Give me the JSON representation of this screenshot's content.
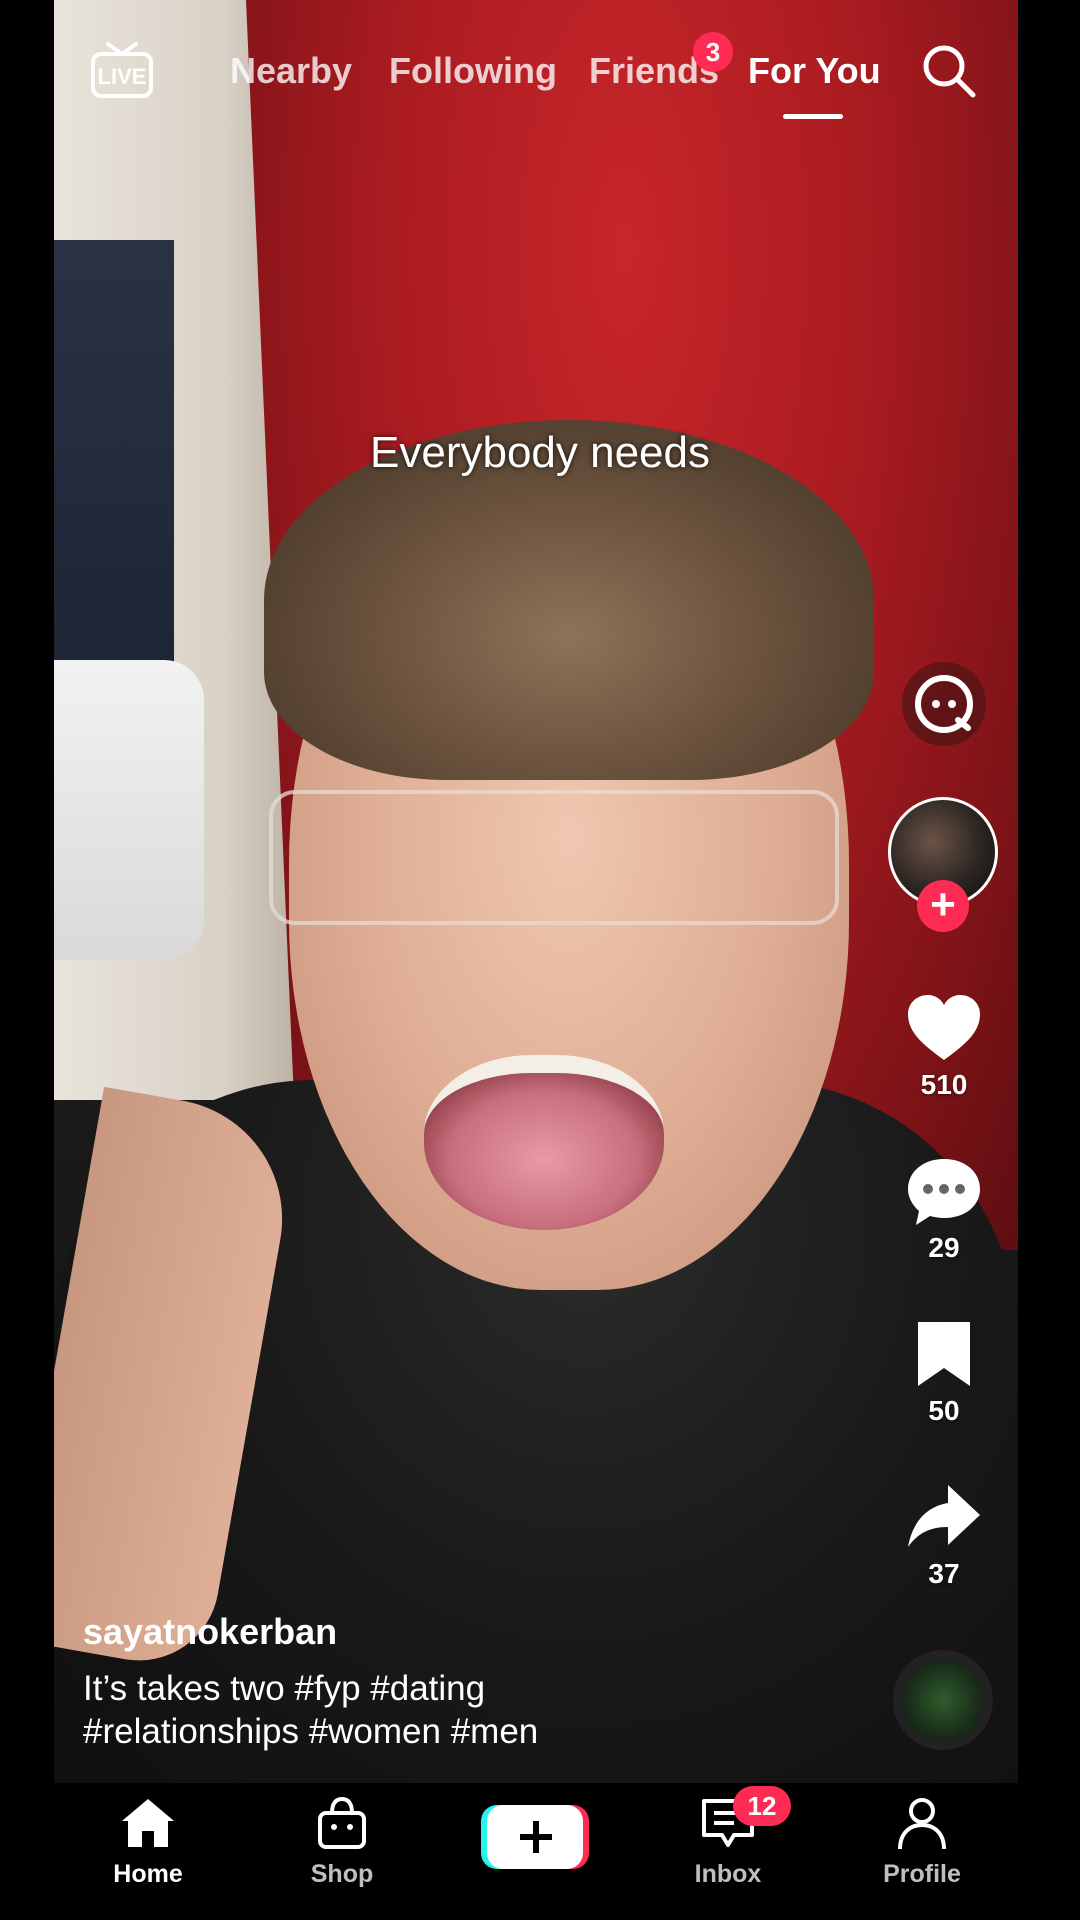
{
  "top_nav": {
    "live_label": "LIVE",
    "tabs": [
      {
        "label": "Nearby"
      },
      {
        "label": "Following"
      },
      {
        "label": "Friends",
        "badge": "3"
      },
      {
        "label": "For You"
      }
    ],
    "active_tab": "For You",
    "search_icon": "search-icon"
  },
  "video": {
    "caption": "Everybody needs"
  },
  "right_rail": {
    "likes": "510",
    "comments": "29",
    "bookmarks": "50",
    "shares": "37"
  },
  "post": {
    "username": "sayatnokerban",
    "description_line1": "It’s takes two #fyp #dating",
    "description_line2": "#relationships #women #men"
  },
  "bottom_nav": {
    "home": "Home",
    "shop": "Shop",
    "create": "+",
    "inbox": "Inbox",
    "inbox_badge": "12",
    "profile": "Profile"
  },
  "colors": {
    "badge": "#fe2c55",
    "create_left": "#25f4ee",
    "create_right": "#fe2c55"
  }
}
